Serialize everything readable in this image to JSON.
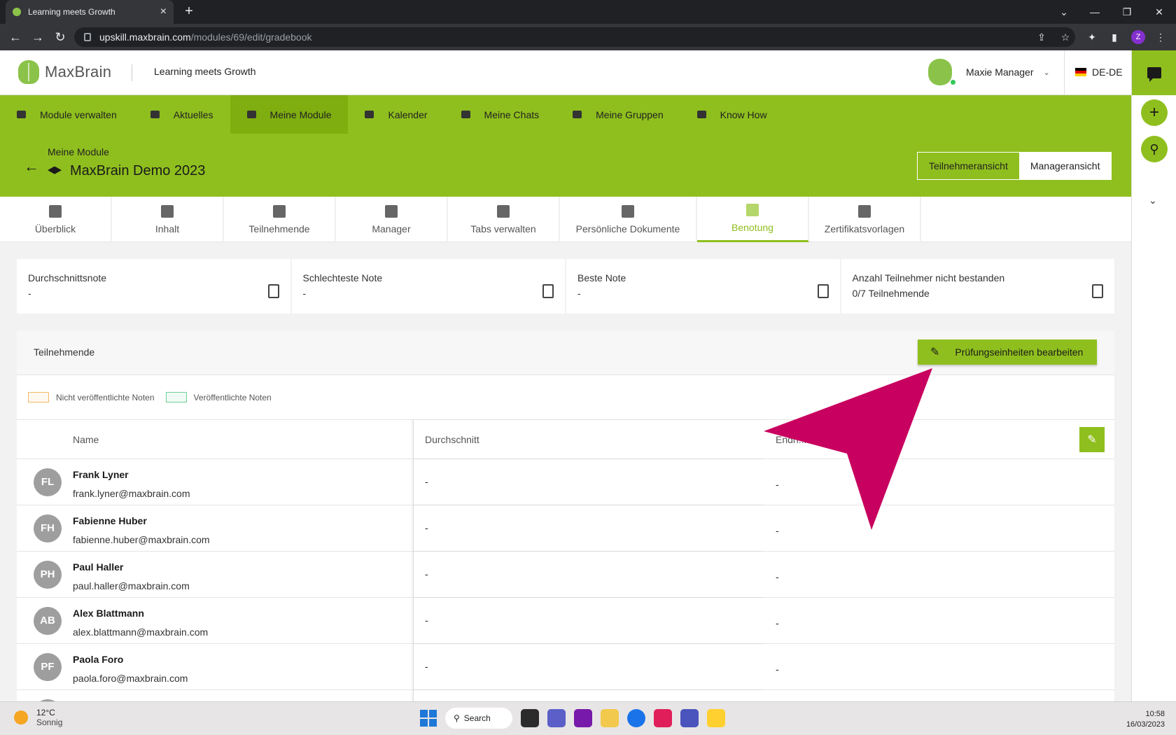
{
  "browser": {
    "tab_title": "Learning meets Growth",
    "url_host": "upskill.maxbrain.com",
    "url_path": "/modules/69/edit/gradebook",
    "profile_initial": "Z"
  },
  "header": {
    "brand": "MaxBrain",
    "tagline": "Learning meets Growth",
    "user_name": "Maxie Manager",
    "language": "DE-DE"
  },
  "nav": {
    "items": [
      {
        "label": "Module verwalten"
      },
      {
        "label": "Aktuelles"
      },
      {
        "label": "Meine Module"
      },
      {
        "label": "Kalender"
      },
      {
        "label": "Meine Chats"
      },
      {
        "label": "Meine Gruppen"
      },
      {
        "label": "Know How"
      }
    ],
    "active_index": 2
  },
  "module": {
    "breadcrumb": "Meine Module",
    "title": "MaxBrain Demo 2023",
    "view_participant": "Teilnehmeransicht",
    "view_manager": "Manageransicht"
  },
  "tabs": [
    {
      "label": "Überblick"
    },
    {
      "label": "Inhalt"
    },
    {
      "label": "Teilnehmende"
    },
    {
      "label": "Manager"
    },
    {
      "label": "Tabs verwalten"
    },
    {
      "label": "Persönliche Dokumente"
    },
    {
      "label": "Benotung"
    },
    {
      "label": "Zertifikatsvorlagen"
    }
  ],
  "stats": [
    {
      "label": "Durchschnittsnote",
      "value": "-"
    },
    {
      "label": "Schlechteste Note",
      "value": "-"
    },
    {
      "label": "Beste Note",
      "value": "-"
    },
    {
      "label": "Anzahl Teilnehmer nicht bestanden",
      "value": "0/7 Teilnehmende"
    }
  ],
  "participants": {
    "title": "Teilnehmende",
    "edit_button": "Prüfungseinheiten bearbeiten",
    "legend_unpublished": "Nicht veröffentlichte Noten",
    "legend_published": "Veröffentlichte Noten",
    "col_name": "Name",
    "col_average": "Durchschnitt",
    "col_third": "Endn...",
    "rows": [
      {
        "initials": "FL",
        "name": "Frank Lyner",
        "email": "frank.lyner@maxbrain.com",
        "average": "-",
        "final": "-"
      },
      {
        "initials": "FH",
        "name": "Fabienne Huber",
        "email": "fabienne.huber@maxbrain.com",
        "average": "-",
        "final": "-"
      },
      {
        "initials": "PH",
        "name": "Paul Haller",
        "email": "paul.haller@maxbrain.com",
        "average": "-",
        "final": "-"
      },
      {
        "initials": "AB",
        "name": "Alex Blattmann",
        "email": "alex.blattmann@maxbrain.com",
        "average": "-",
        "final": "-"
      },
      {
        "initials": "PF",
        "name": "Paola Foro",
        "email": "paola.foro@maxbrain.com",
        "average": "-",
        "final": "-"
      }
    ]
  },
  "taskbar": {
    "temperature": "12°C",
    "weather": "Sonnig",
    "search": "Search",
    "time": "10:58",
    "date": "16/03/2023"
  },
  "colors": {
    "brand_green": "#8fbf1e",
    "arrow_magenta": "#c8005f"
  }
}
